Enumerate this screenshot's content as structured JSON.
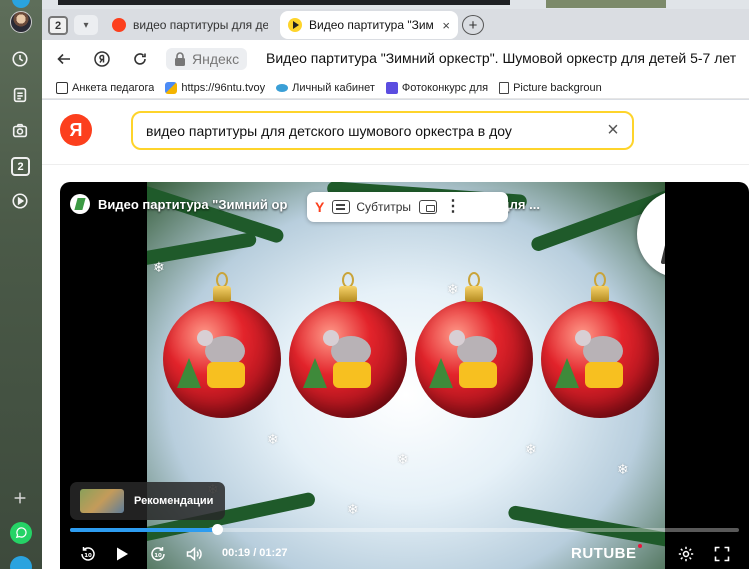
{
  "sidebar": {
    "badge": "2"
  },
  "tabs": {
    "count": "2",
    "items": [
      {
        "label": "видео партитуры для детс",
        "active": false
      },
      {
        "label": "Видео партитура \"Зим",
        "active": true,
        "close": "×"
      }
    ],
    "new_tab": "+"
  },
  "addressbar": {
    "site": "Яндекс",
    "title": "Видео партитура \"Зимний оркестр\". Шумовой оркестр для детей 5-7 лет"
  },
  "bookmarks": [
    {
      "label": "Анкета педагога"
    },
    {
      "label": "https://96ntu.tvoy"
    },
    {
      "label": "Личный кабинет"
    },
    {
      "label": "Фотоконкурс для"
    },
    {
      "label": "Picture backgroun"
    }
  ],
  "search": {
    "logo": "Я",
    "query": "видео партитуры для детского шумового оркестра в доу",
    "clear": "×"
  },
  "video": {
    "title": "Видео партитура \"Зимний ор",
    "title_tail": "для ...",
    "overlay": {
      "y_icon": "Y",
      "subtitles": "Субтитры",
      "more": "⋮"
    },
    "recommendations": "Рекомендации",
    "time": "00:19 / 01:27",
    "progress": 0.22,
    "brand": "RUTUBE"
  },
  "colors": {
    "accent": "#fed42b",
    "yandex_red": "#fc3f1d",
    "progress_blue": "#2d9cf0"
  }
}
